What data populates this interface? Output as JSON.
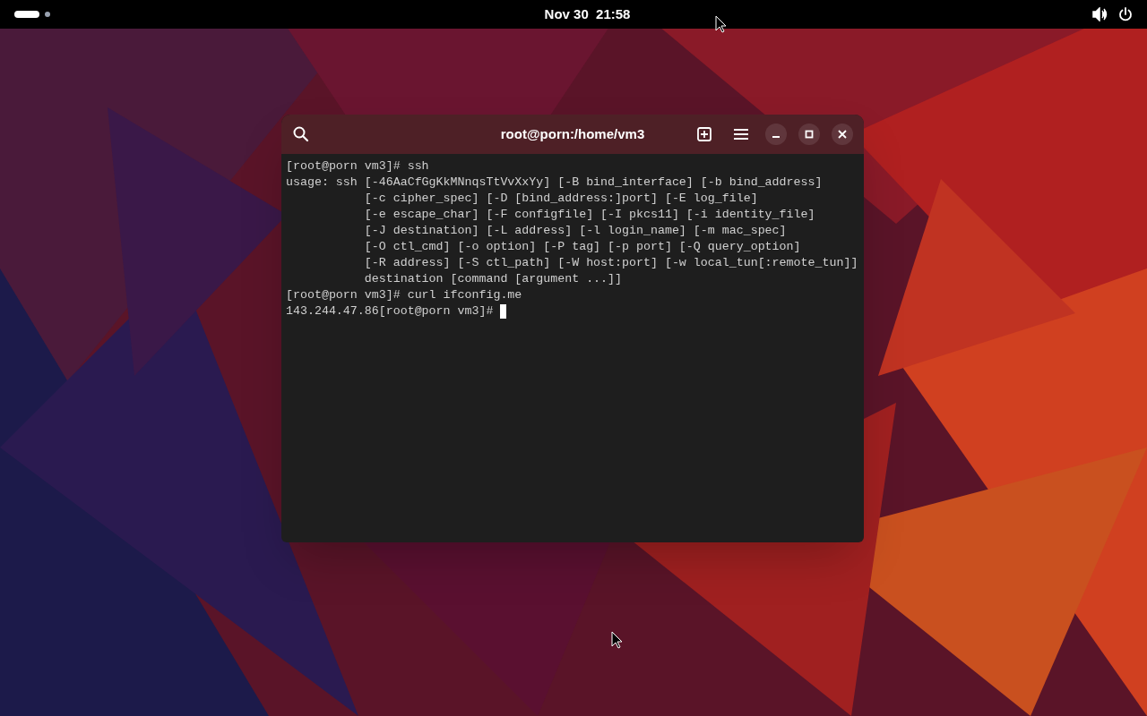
{
  "top_bar": {
    "clock": "Nov 30  21:58"
  },
  "terminal": {
    "title": "root@porn:/home/vm3",
    "lines": [
      "[root@porn vm3]# ssh",
      "usage: ssh [-46AaCfGgKkMNnqsTtVvXxYy] [-B bind_interface] [-b bind_address]",
      "           [-c cipher_spec] [-D [bind_address:]port] [-E log_file]",
      "           [-e escape_char] [-F configfile] [-I pkcs11] [-i identity_file]",
      "           [-J destination] [-L address] [-l login_name] [-m mac_spec]",
      "           [-O ctl_cmd] [-o option] [-P tag] [-p port] [-Q query_option]",
      "           [-R address] [-S ctl_path] [-W host:port] [-w local_tun[:remote_tun]]",
      "           destination [command [argument ...]]",
      "[root@porn vm3]# curl ifconfig.me",
      "143.244.47.86[root@porn vm3]# "
    ]
  }
}
